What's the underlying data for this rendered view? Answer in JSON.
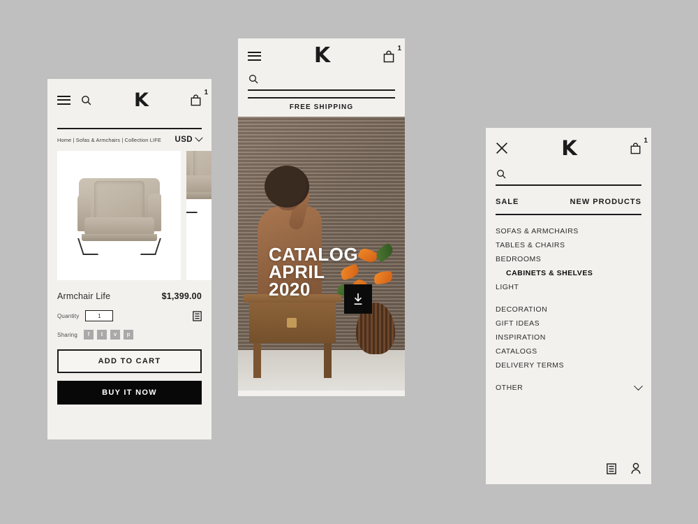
{
  "canvas": {
    "background": "#bfbfbf"
  },
  "brand": {
    "logo": "K",
    "accent": "#1b1b1b",
    "panel_bg": "#f2f1ee"
  },
  "pdp": {
    "header": {
      "menu_icon": "hamburger-icon",
      "search_icon": "search-icon",
      "logo": "K",
      "bag_icon": "shopping-bag-icon",
      "bag_count": "1"
    },
    "breadcrumb": "Home | Sofas & Armchairs | Collection LIFE",
    "currency": "USD",
    "product": {
      "title": "Armchair Life",
      "price": "$1,399.00",
      "quantity_label": "Quantity",
      "quantity_value": "1",
      "details_icon": "list-details-icon",
      "sharing_label": "Sharing",
      "share_icons": [
        "facebook-icon",
        "twitter-icon",
        "viber-icon",
        "pinterest-icon"
      ],
      "share_glyphs": [
        "f",
        "t",
        "v",
        "p"
      ]
    },
    "buttons": {
      "add_to_cart": "ADD TO CART",
      "buy_it_now": "BUY IT NOW"
    }
  },
  "promo": {
    "header": {
      "menu_icon": "hamburger-icon",
      "logo": "K",
      "bag_icon": "shopping-bag-icon",
      "bag_count": "1"
    },
    "search_placeholder": "",
    "shipping_banner": "FREE SHIPPING",
    "headline_line1": "CATALOG",
    "headline_line2": "APRIL",
    "headline_line3": "2020",
    "download_icon": "download-icon"
  },
  "menu": {
    "header": {
      "close_icon": "close-icon",
      "logo": "K",
      "bag_icon": "shopping-bag-icon",
      "bag_count": "1"
    },
    "search_placeholder": "",
    "tabs": [
      {
        "label": "SALE"
      },
      {
        "label": "NEW PRODUCTS"
      }
    ],
    "categories": [
      {
        "label": "SOFAS & ARMCHAIRS",
        "active": false
      },
      {
        "label": "TABLES & CHAIRS",
        "active": false
      },
      {
        "label": "BEDROOMS",
        "active": false
      },
      {
        "label": "CABINETS & SHELVES",
        "active": true
      },
      {
        "label": "LIGHT",
        "active": false
      }
    ],
    "pages": [
      {
        "label": "DECORATION"
      },
      {
        "label": "GIFT IDEAS"
      },
      {
        "label": "INSPIRATION"
      },
      {
        "label": "CATALOGS"
      },
      {
        "label": "DELIVERY TERMS"
      }
    ],
    "other": {
      "label": "OTHER",
      "chevron": "chevron-down-icon"
    },
    "footer_icons": [
      "list-details-icon",
      "account-icon"
    ]
  }
}
